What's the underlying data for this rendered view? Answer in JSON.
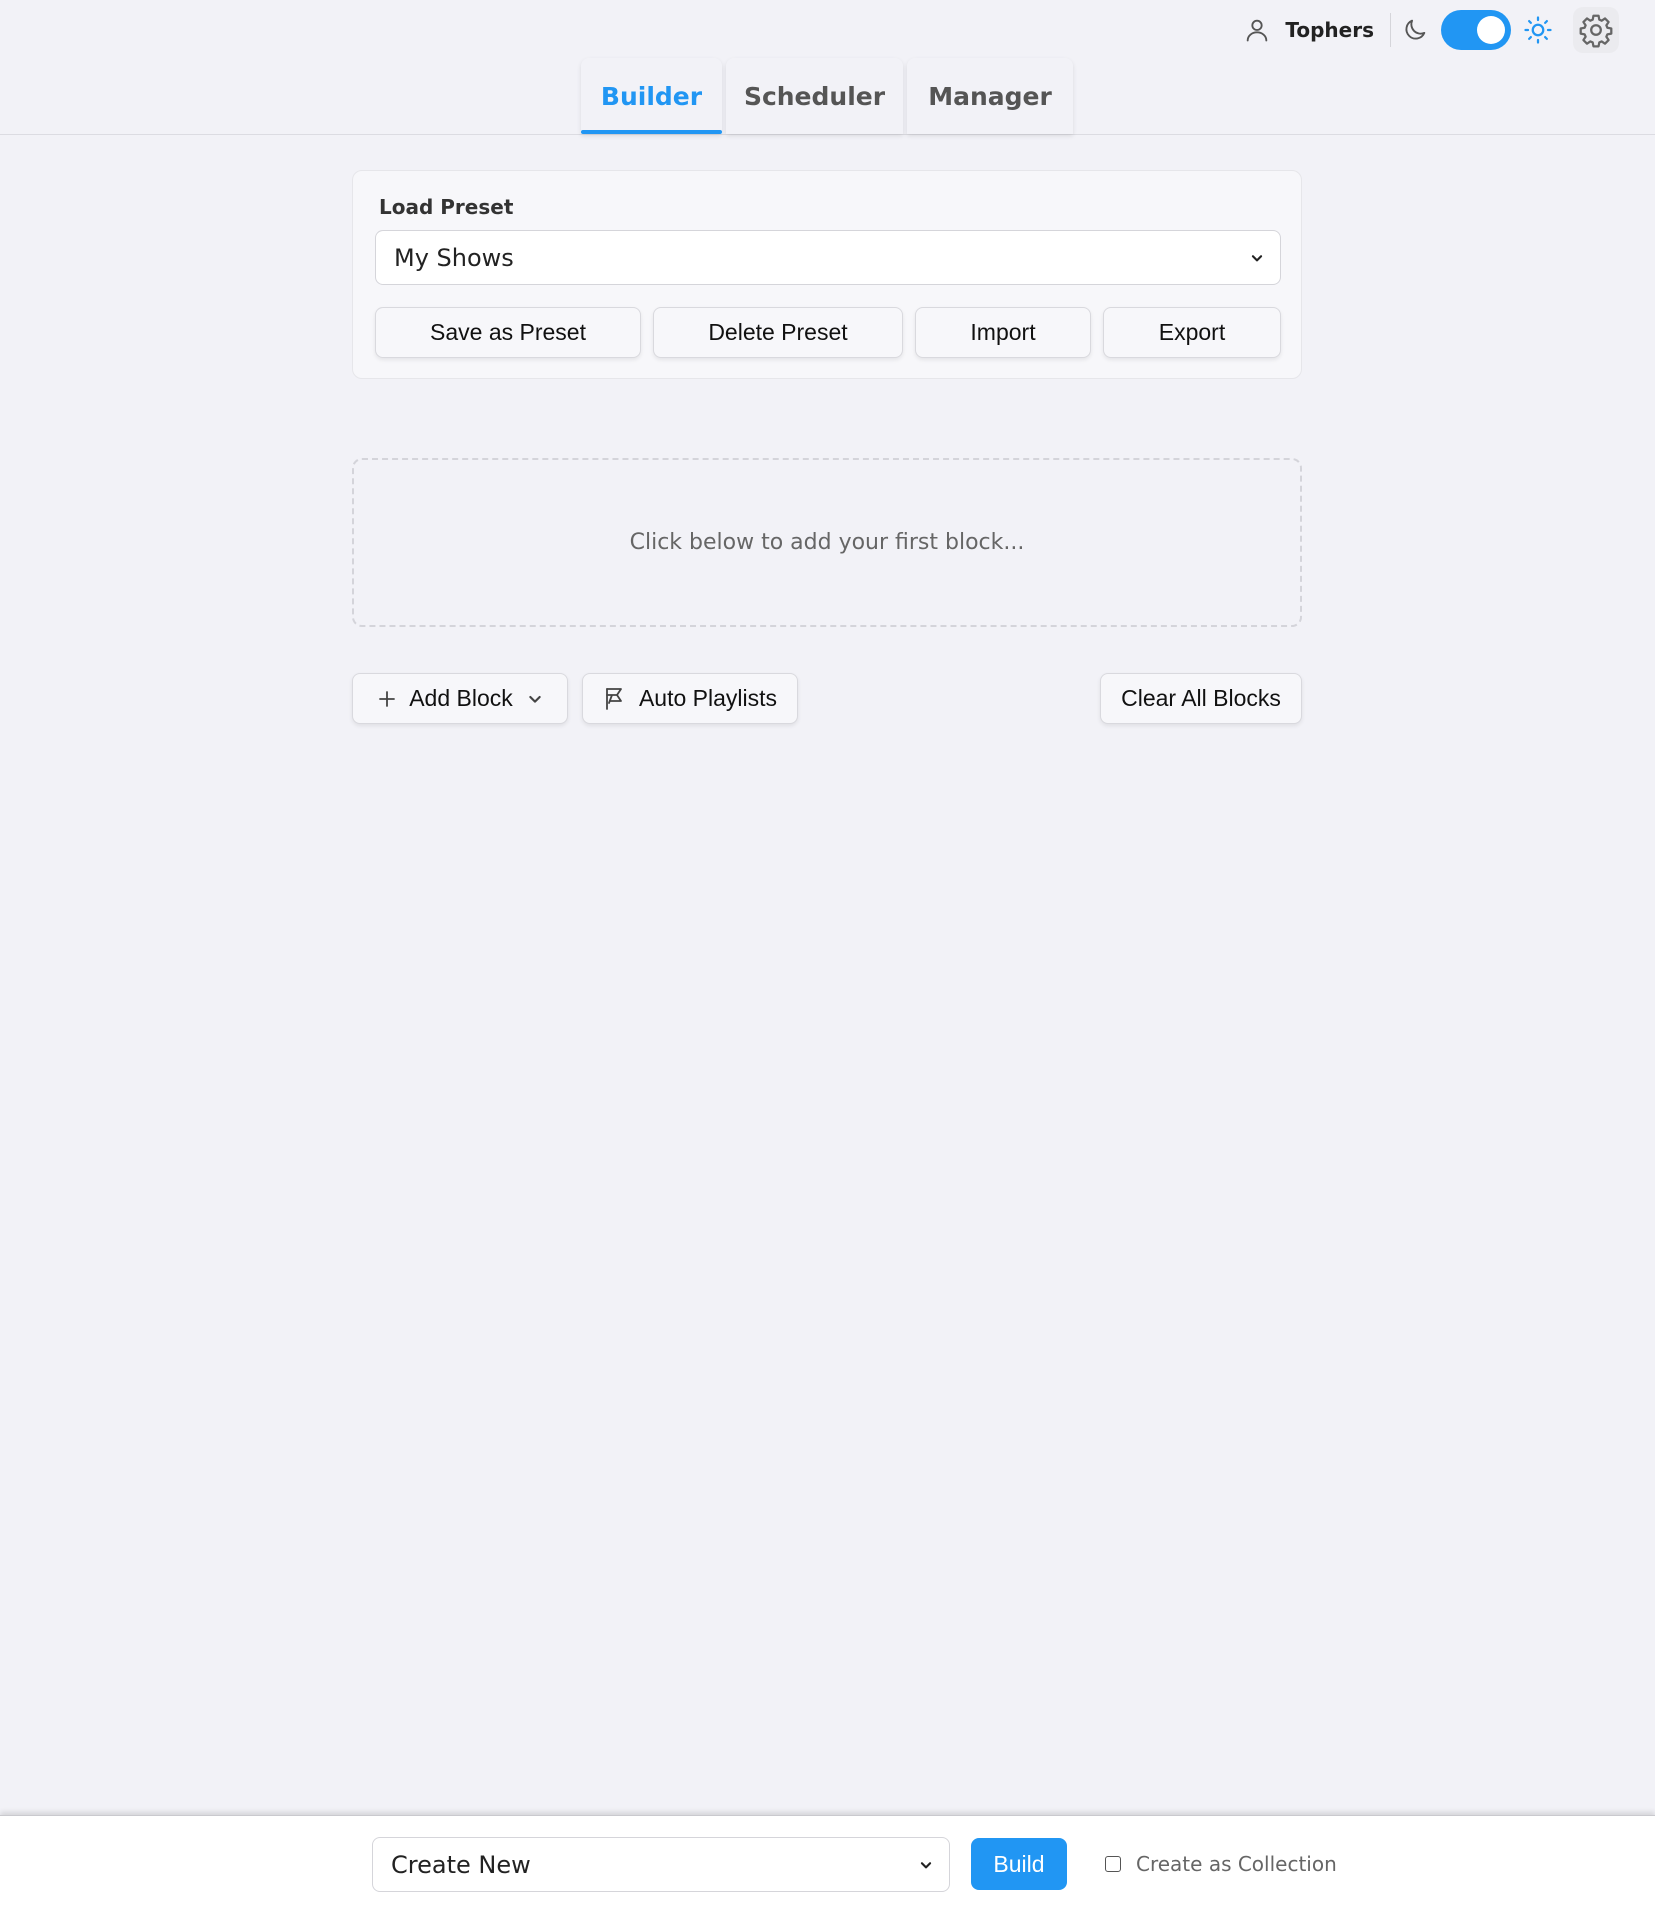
{
  "header": {
    "user_name": "Tophers",
    "theme_toggle_on": true,
    "accent_color": "#2196f3",
    "icons": [
      "user-icon",
      "moon-icon",
      "sun-icon",
      "gear-icon"
    ],
    "tabs": [
      {
        "label": "Builder",
        "active": true
      },
      {
        "label": "Scheduler",
        "active": false
      },
      {
        "label": "Manager",
        "active": false
      }
    ]
  },
  "preset": {
    "label": "Load Preset",
    "selected": "My Shows",
    "buttons": {
      "save": "Save as Preset",
      "delete": "Delete Preset",
      "import": "Import",
      "export": "Export"
    }
  },
  "blocks": {
    "empty_message": "Click below to add your first block..."
  },
  "actions": {
    "add_block": "Add Block",
    "auto_playlists": "Auto Playlists",
    "clear_all": "Clear All Blocks"
  },
  "footer": {
    "target_selected": "Create New",
    "build": "Build",
    "create_as_collection": "Create as Collection",
    "create_as_collection_checked": false
  }
}
